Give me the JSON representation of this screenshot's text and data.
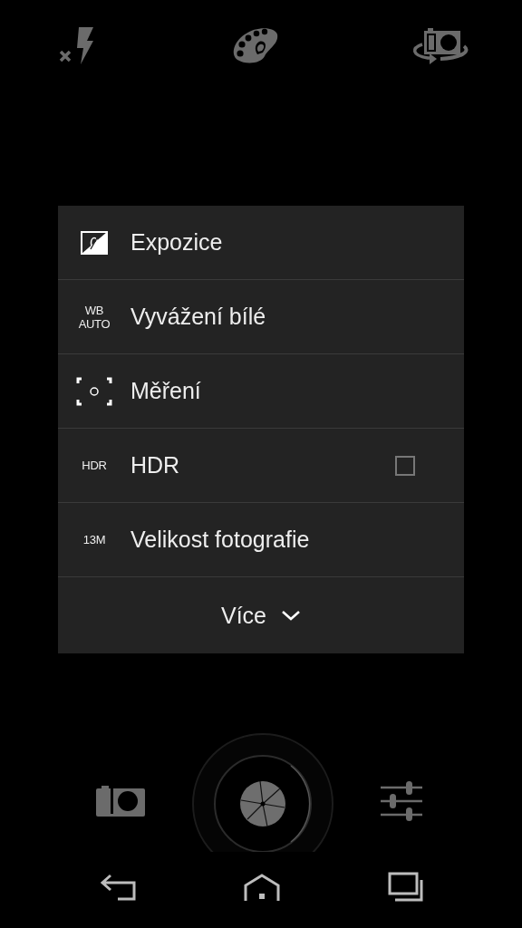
{
  "menu": {
    "items": [
      {
        "kind": "exposure",
        "label": "Expozice"
      },
      {
        "kind": "badge",
        "badge": [
          "WB",
          "AUTO"
        ],
        "label": "Vyvážení bílé"
      },
      {
        "kind": "metering",
        "label": "Měření"
      },
      {
        "kind": "checkbox",
        "badge": [
          "HDR"
        ],
        "label": "HDR",
        "checked": false
      },
      {
        "kind": "badge",
        "badge": [
          "13M"
        ],
        "label": "Velikost fotografie"
      }
    ],
    "more": {
      "label": "Více"
    }
  }
}
